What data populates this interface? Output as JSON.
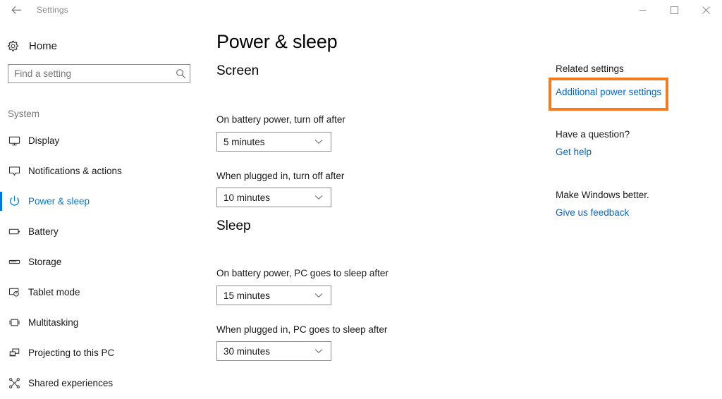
{
  "titlebar": {
    "back_icon": "back-arrow-icon",
    "title": "Settings",
    "minimize_label": "─",
    "maximize_label": "□",
    "close_label": "✕"
  },
  "sidebar": {
    "home": {
      "label": "Home",
      "icon": "gear-icon"
    },
    "search": {
      "placeholder": "Find a setting",
      "value": "",
      "icon": "search-icon"
    },
    "group_title": "System",
    "items": [
      {
        "label": "Display",
        "icon": "monitor-icon",
        "selected": false
      },
      {
        "label": "Notifications & actions",
        "icon": "notification-bubble-icon",
        "selected": false
      },
      {
        "label": "Power & sleep",
        "icon": "power-icon",
        "selected": true
      },
      {
        "label": "Battery",
        "icon": "battery-icon",
        "selected": false
      },
      {
        "label": "Storage",
        "icon": "storage-drive-icon",
        "selected": false
      },
      {
        "label": "Tablet mode",
        "icon": "tablet-touch-icon",
        "selected": false
      },
      {
        "label": "Multitasking",
        "icon": "multitasking-icon",
        "selected": false
      },
      {
        "label": "Projecting to this PC",
        "icon": "projecting-icon",
        "selected": false
      },
      {
        "label": "Shared experiences",
        "icon": "shared-experiences-icon",
        "selected": false
      }
    ]
  },
  "main": {
    "page_title": "Power & sleep",
    "sections": [
      {
        "heading": "Screen",
        "fields": [
          {
            "label": "On battery power, turn off after",
            "value": "5 minutes"
          },
          {
            "label": "When plugged in, turn off after",
            "value": "10 minutes"
          }
        ]
      },
      {
        "heading": "Sleep",
        "fields": [
          {
            "label": "On battery power, PC goes to sleep after",
            "value": "15 minutes"
          },
          {
            "label": "When plugged in, PC goes to sleep after",
            "value": "30 minutes"
          }
        ]
      }
    ]
  },
  "right_panel": {
    "groups": [
      {
        "heading": "Related settings",
        "link": "Additional power settings",
        "highlighted": true
      },
      {
        "heading": "Have a question?",
        "link": "Get help",
        "highlighted": false
      },
      {
        "heading": "Make Windows better.",
        "link": "Give us feedback",
        "highlighted": false
      }
    ]
  },
  "colors": {
    "accent_blue": "#0078d7",
    "link_blue": "#0066cc",
    "highlight_orange": "#f47b20",
    "muted_text": "#767676"
  }
}
